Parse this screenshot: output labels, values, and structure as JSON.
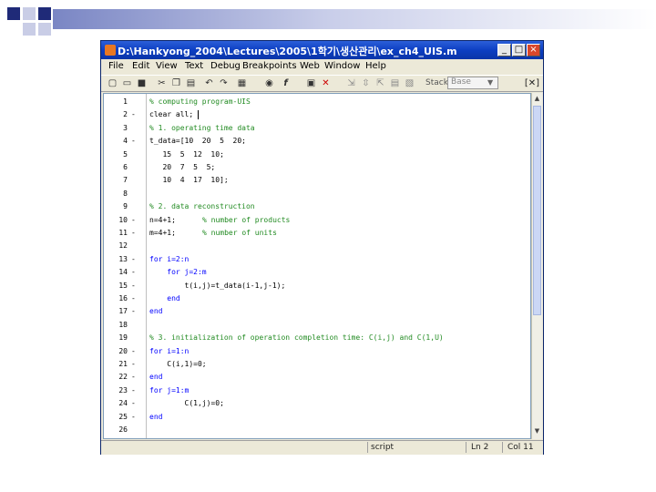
{
  "window": {
    "title": "D:\\Hankyong_2004\\Lectures\\2005\\1학기\\생산관리\\ex_ch4_UIS.m"
  },
  "menu": [
    "File",
    "Edit",
    "View",
    "Text",
    "Debug",
    "Breakpoints",
    "Web",
    "Window",
    "Help"
  ],
  "toolbar": {
    "stack_label": "Stack:",
    "stack_value": "Base",
    "tools": [
      "new-file-icon",
      "open-icon",
      "save-icon",
      "cut-icon",
      "copy-icon",
      "paste-icon",
      "undo-icon",
      "redo-icon",
      "print-icon",
      "find-icon",
      "function-icon",
      "set-breakpoint-icon",
      "clear-breakpoints-icon",
      "step-icon",
      "step-in-icon",
      "step-out-icon",
      "continue-icon",
      "exit-debug-icon"
    ]
  },
  "editor": {
    "lines": [
      {
        "n": "1",
        "dash": "",
        "text": "% computing program-UIS",
        "kind": "comment"
      },
      {
        "n": "2",
        "dash": "-",
        "text": "clear all;",
        "kind": "plain"
      },
      {
        "n": "3",
        "dash": "",
        "text": "% 1. operating time data",
        "kind": "comment"
      },
      {
        "n": "4",
        "dash": "-",
        "text": "t_data=[10  20  5  20;",
        "kind": "plain"
      },
      {
        "n": "5",
        "dash": "",
        "text": "   15  5  12  10;",
        "kind": "plain"
      },
      {
        "n": "6",
        "dash": "",
        "text": "   20  7  5  5;",
        "kind": "plain"
      },
      {
        "n": "7",
        "dash": "",
        "text": "   10  4  17  10];",
        "kind": "plain"
      },
      {
        "n": "8",
        "dash": "",
        "text": "",
        "kind": "plain"
      },
      {
        "n": "9",
        "dash": "",
        "text": "% 2. data reconstruction",
        "kind": "comment"
      },
      {
        "n": "10",
        "dash": "-",
        "text": "n=4+1;        % number of products",
        "kind": "mixed",
        "code": "n=4+1;",
        "comment": "% number of products"
      },
      {
        "n": "11",
        "dash": "-",
        "text": "m=4+1;        % number of units",
        "kind": "mixed",
        "code": "m=4+1;",
        "comment": "% number of units"
      },
      {
        "n": "12",
        "dash": "",
        "text": "",
        "kind": "plain"
      },
      {
        "n": "13",
        "dash": "-",
        "text": "for i=2:n",
        "kind": "keyword"
      },
      {
        "n": "14",
        "dash": "-",
        "text": "    for j=2:m",
        "kind": "keyword"
      },
      {
        "n": "15",
        "dash": "-",
        "text": "        t(i,j)=t_data(i-1,j-1);",
        "kind": "plain"
      },
      {
        "n": "16",
        "dash": "-",
        "text": "    end",
        "kind": "keyword"
      },
      {
        "n": "17",
        "dash": "-",
        "text": "end",
        "kind": "keyword"
      },
      {
        "n": "18",
        "dash": "",
        "text": "",
        "kind": "plain"
      },
      {
        "n": "19",
        "dash": "",
        "text": "% 3. initialization of operation completion time: C(i,j) and C(1,U)",
        "kind": "comment"
      },
      {
        "n": "20",
        "dash": "-",
        "text": "for i=1:n",
        "kind": "keyword"
      },
      {
        "n": "21",
        "dash": "-",
        "text": "    C(i,1)=0;",
        "kind": "plain"
      },
      {
        "n": "22",
        "dash": "-",
        "text": "end",
        "kind": "keyword"
      },
      {
        "n": "23",
        "dash": "-",
        "text": "for j=1:m",
        "kind": "keyword"
      },
      {
        "n": "24",
        "dash": "-",
        "text": "        C(1,j)=0;",
        "kind": "plain"
      },
      {
        "n": "25",
        "dash": "-",
        "text": "end",
        "kind": "keyword"
      },
      {
        "n": "26",
        "dash": "",
        "text": "",
        "kind": "plain"
      }
    ]
  },
  "status": {
    "mode": "script",
    "line": "Ln 2",
    "col": "Col 11"
  },
  "colors": {
    "keyword": "#0000ff",
    "comment": "#228b22",
    "text": "#000000",
    "title_bar": "#0d3fc2"
  }
}
